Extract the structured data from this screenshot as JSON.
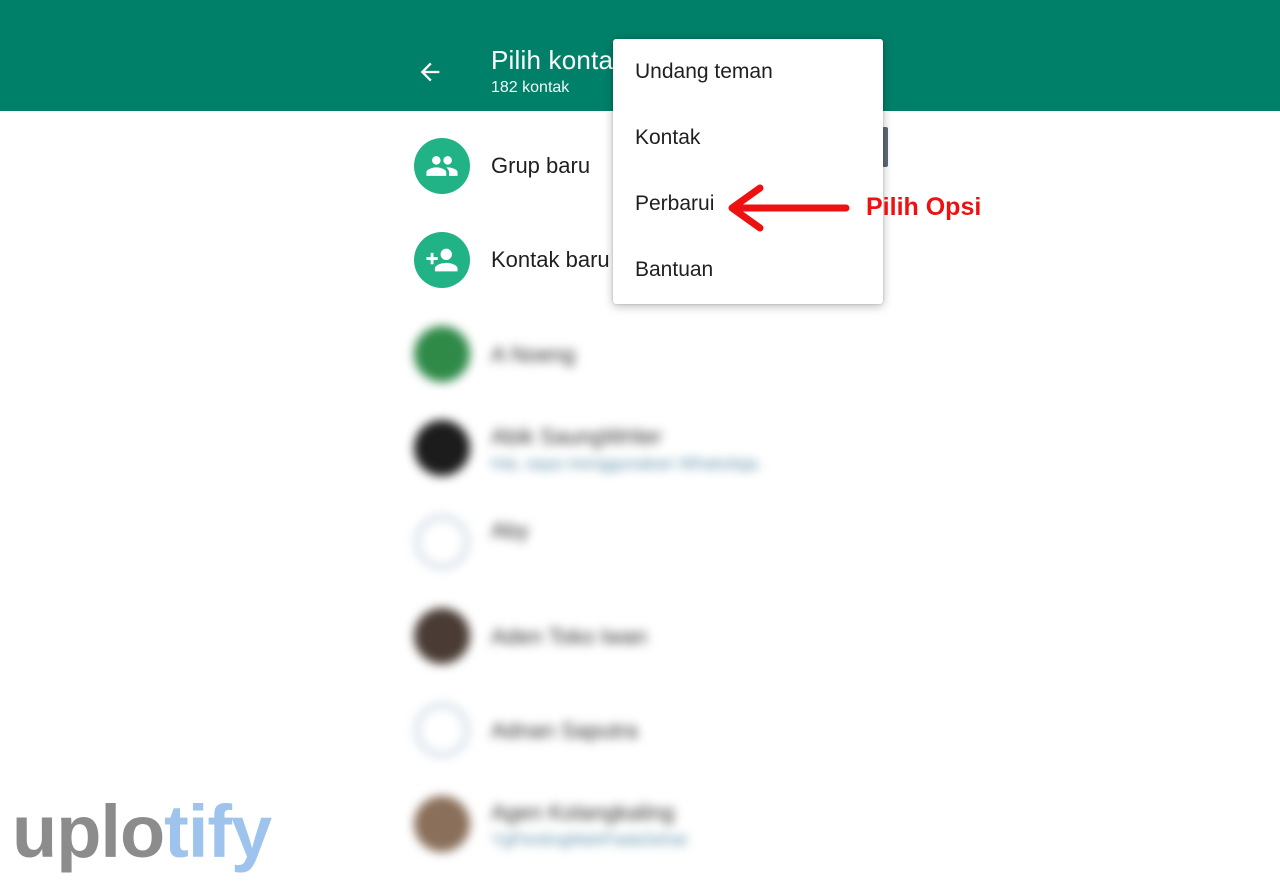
{
  "app": {
    "title": "Pilih kontak",
    "subtitle": "182 kontak",
    "accent_color": "#008069",
    "avatar_color": "#21b286"
  },
  "actions": [
    {
      "label": "Grup baru",
      "icon": "group-icon"
    },
    {
      "label": "Kontak baru",
      "icon": "add-person-icon"
    }
  ],
  "contacts": [
    {
      "name": "A Noeng",
      "status": ""
    },
    {
      "name": "Abik SaungWriter",
      "status": "Hai, saya menggunakan WhatsApp."
    },
    {
      "name": "Aby",
      "status": ""
    },
    {
      "name": "Aden Toko Iwan",
      "status": ""
    },
    {
      "name": "Adnan Saputra",
      "status": ""
    },
    {
      "name": "Agen Kolangkaling",
      "status": "YgPentingMahPadaSehat"
    }
  ],
  "menu": {
    "items": [
      "Undang teman",
      "Kontak",
      "Perbarui",
      "Bantuan"
    ]
  },
  "annotation": {
    "text": "Pilih Opsi",
    "color": "#ee1111"
  },
  "watermark": {
    "part1": "uplo",
    "part2": "tify"
  }
}
